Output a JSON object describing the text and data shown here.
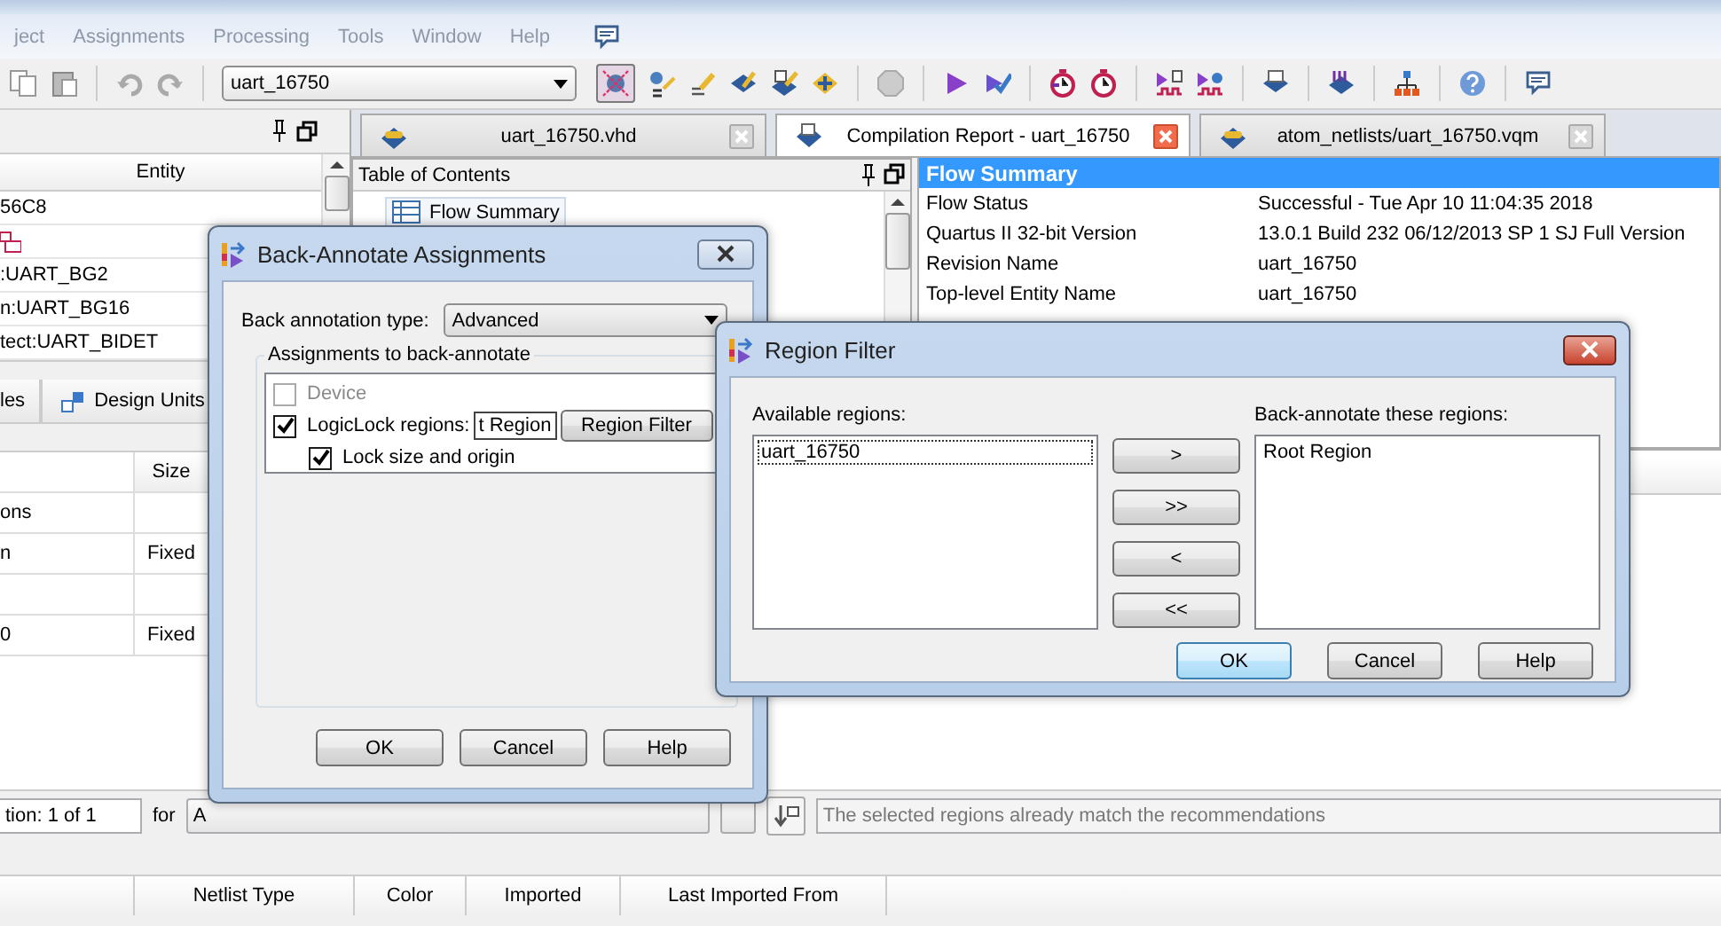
{
  "menu": [
    "ject",
    "Assignments",
    "Processing",
    "Tools",
    "Window",
    "Help"
  ],
  "toolbar": {
    "project": "uart_16750"
  },
  "left_panel": {
    "column": "Entity",
    "rows": [
      {
        "kind": "text",
        "text": "56C8"
      },
      {
        "kind": "icon"
      },
      {
        "kind": "text",
        "text": ":UART_BG2"
      },
      {
        "kind": "text",
        "text": "n:UART_BG16"
      },
      {
        "kind": "text",
        "text": "tect:UART_BIDET"
      }
    ]
  },
  "left_tabs": [
    "les",
    "Design Units"
  ],
  "left_table": {
    "column": "Size",
    "rows": [
      {
        "name": "ons"
      },
      {
        "name": "n",
        "size": "Fixed"
      },
      {},
      {
        "name": "0",
        "size": "Fixed"
      }
    ]
  },
  "doc_tabs": [
    {
      "label": "uart_16750.vhd",
      "selected": false
    },
    {
      "label": "Compilation Report - uart_16750",
      "selected": true
    },
    {
      "label": "atom_netlists/uart_16750.vqm",
      "selected": false
    }
  ],
  "toc": {
    "title": "Table of Contents",
    "items": [
      {
        "label": "Flow Summary",
        "selected": true
      }
    ]
  },
  "flow_summary": {
    "title": "Flow Summary",
    "rows": [
      {
        "name": "Flow Status",
        "value": "Successful - Tue Apr 10 11:04:35 2018"
      },
      {
        "name": "Quartus II 32-bit Version",
        "value": "13.0.1 Build 232 06/12/2013 SP 1 SJ Full Version"
      },
      {
        "name": "Revision Name",
        "value": "uart_16750"
      },
      {
        "name": "Top-level Entity Name",
        "value": "uart_16750"
      }
    ]
  },
  "bottom_bar": {
    "location": "tion: 1 of 1",
    "for_label": "for",
    "filter": "A",
    "message": "The selected regions already match the recommendations"
  },
  "netlist_table": {
    "columns": [
      "Netlist Type",
      "Color",
      "Imported",
      "Last Imported From"
    ]
  },
  "back_annotate_dialog": {
    "title": "Back-Annotate Assignments",
    "type_label": "Back annotation type:",
    "type_value": "Advanced",
    "group_label": "Assignments to back-annotate",
    "options": [
      {
        "kind": "check",
        "label": "Device",
        "checked": false,
        "disabled": true
      },
      {
        "kind": "region",
        "label": "LogicLock regions:",
        "checked": true,
        "disabled": false,
        "value": "t Region",
        "button": "Region Filter"
      },
      {
        "kind": "sub",
        "label": "Lock size and origin",
        "checked": true,
        "disabled": false
      }
    ],
    "buttons": [
      "OK",
      "Cancel",
      "Help"
    ]
  },
  "region_filter_dialog": {
    "title": "Region Filter",
    "available_label": "Available regions:",
    "available": [
      {
        "label": "uart_16750",
        "selected": true
      }
    ],
    "target_label": "Back-annotate these regions:",
    "target": [
      {
        "label": "Root Region",
        "selected": false
      }
    ],
    "move_buttons": [
      ">",
      ">>",
      "<",
      "<<"
    ],
    "buttons": [
      {
        "label": "OK",
        "default": true
      },
      {
        "label": "Cancel",
        "default": false
      },
      {
        "label": "Help",
        "default": false
      }
    ]
  }
}
